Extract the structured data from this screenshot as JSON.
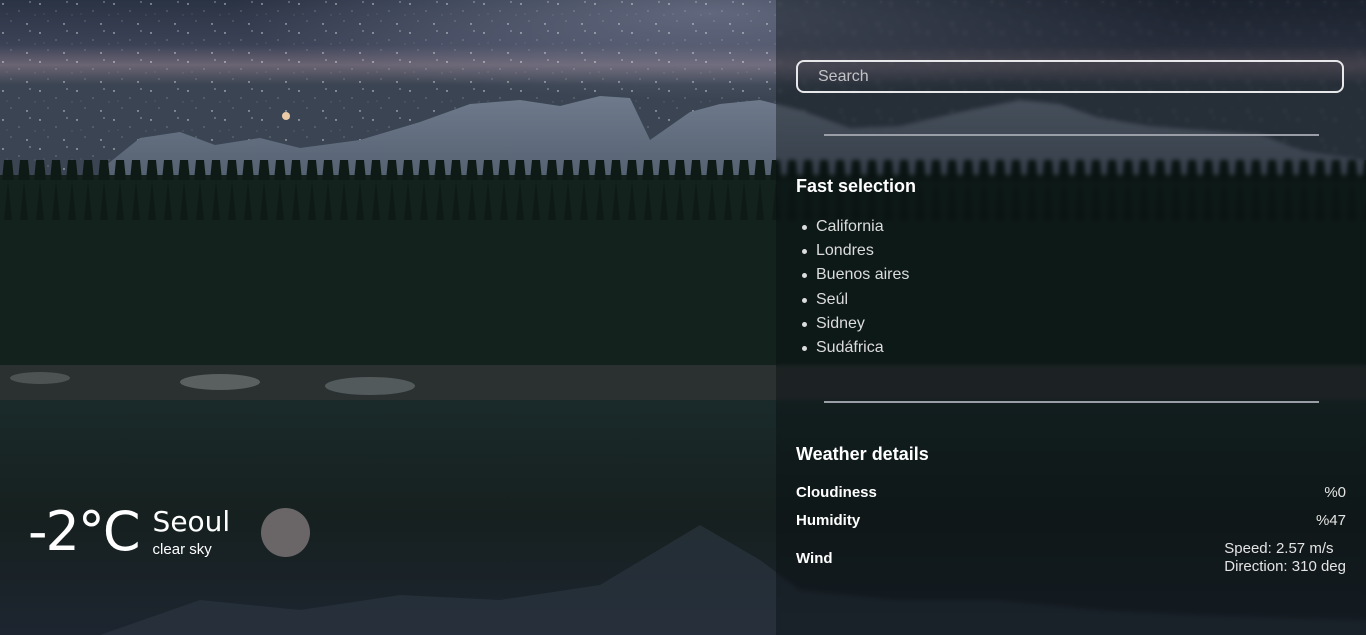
{
  "current": {
    "temperature": "-2°C",
    "city": "Seoul",
    "description": "clear sky",
    "icon": "weather-icon"
  },
  "search": {
    "placeholder": "Search"
  },
  "fast_selection": {
    "title": "Fast selection",
    "cities": [
      "California",
      "Londres",
      "Buenos aires",
      "Seúl",
      "Sidney",
      "Sudáfrica"
    ]
  },
  "details": {
    "title": "Weather details",
    "cloudiness": {
      "label": "Cloudiness",
      "value": "%0"
    },
    "humidity": {
      "label": "Humidity",
      "value": "%47"
    },
    "wind": {
      "label": "Wind",
      "speed": "Speed: 2.57 m/s",
      "direction": "Direction: 310 deg"
    }
  },
  "colors": {
    "panel_overlay": "#060a0e",
    "search_border": "#e8e8ea",
    "divider": "#9a9ea6",
    "weather_icon": "#6a6668"
  }
}
